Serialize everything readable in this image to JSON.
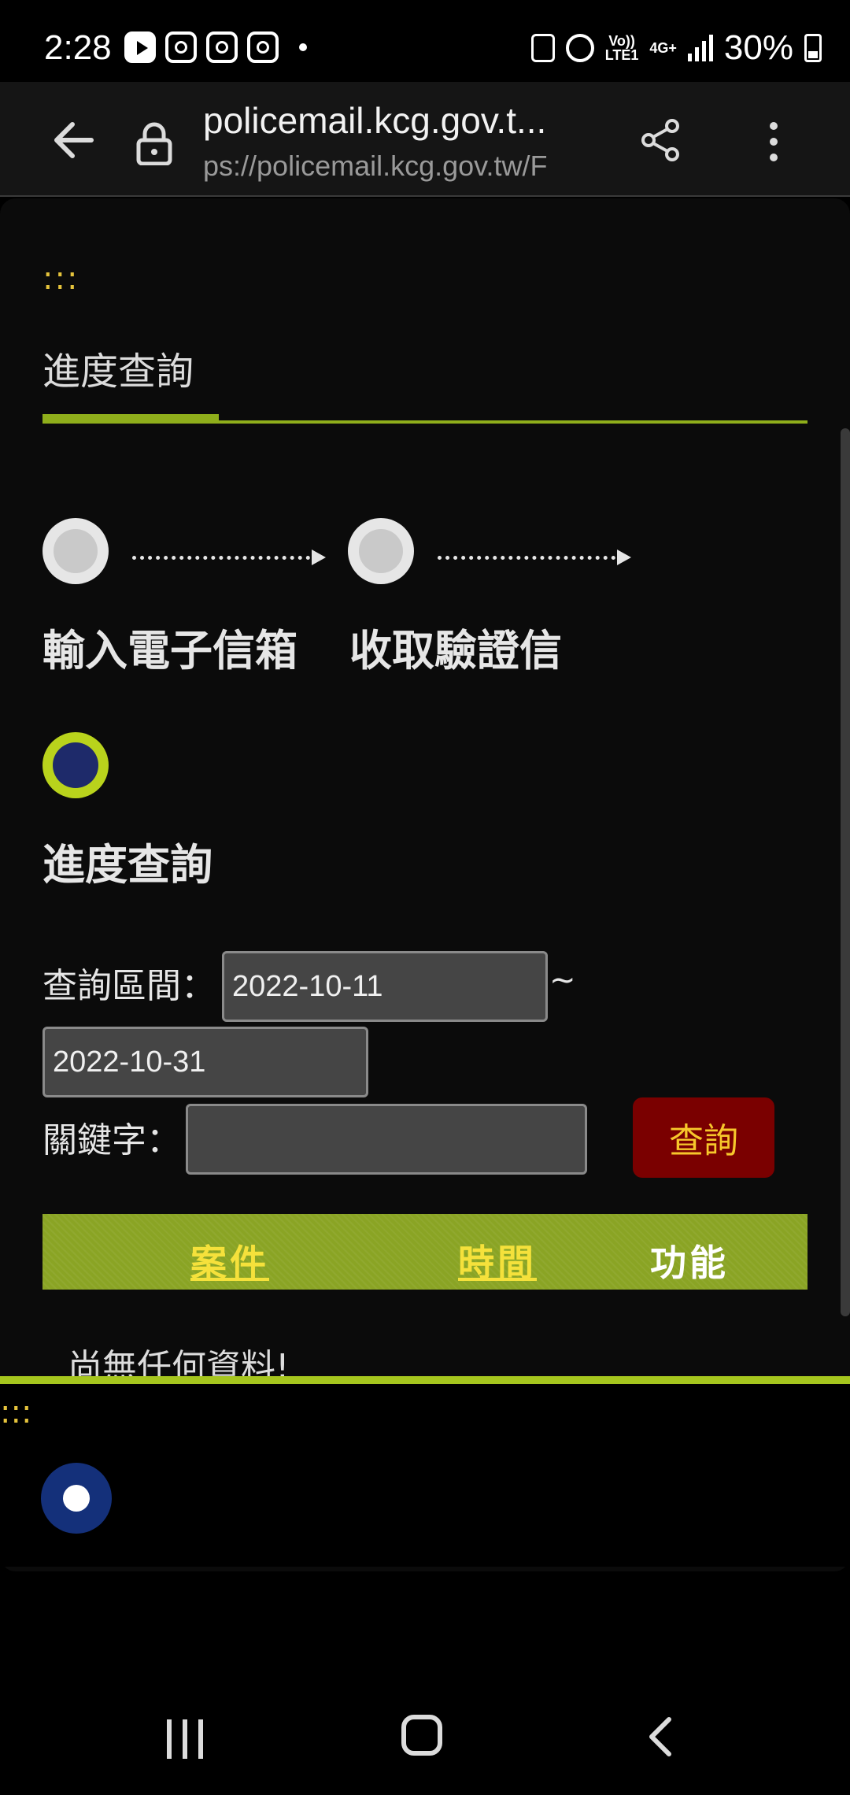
{
  "status_bar": {
    "time": "2:28",
    "network_top": "Vo))",
    "network_bottom": "LTE1",
    "network_type": "4G+",
    "battery": "30%"
  },
  "browser": {
    "url_title": "policemail.kcg.gov.t...",
    "url_full": "ps://policemail.kcg.gov.tw/F"
  },
  "page": {
    "breadcrumb_dots": ":::",
    "title": "進度查詢",
    "steps": [
      {
        "label": "輸入電子信箱",
        "active": false
      },
      {
        "label": "收取驗證信",
        "active": false
      },
      {
        "label": "進度查詢",
        "active": true
      }
    ],
    "form": {
      "date_range_label": "查詢區間：",
      "start_date": "2022-10-11",
      "range_separator": "~",
      "end_date": "2022-10-31",
      "keyword_label": "關鍵字：",
      "keyword_value": "",
      "query_button": "查詢"
    },
    "table": {
      "columns": [
        "案件",
        "時間",
        "功能"
      ],
      "empty_message": "尚無任何資料!"
    },
    "footer_dots": ":::"
  }
}
